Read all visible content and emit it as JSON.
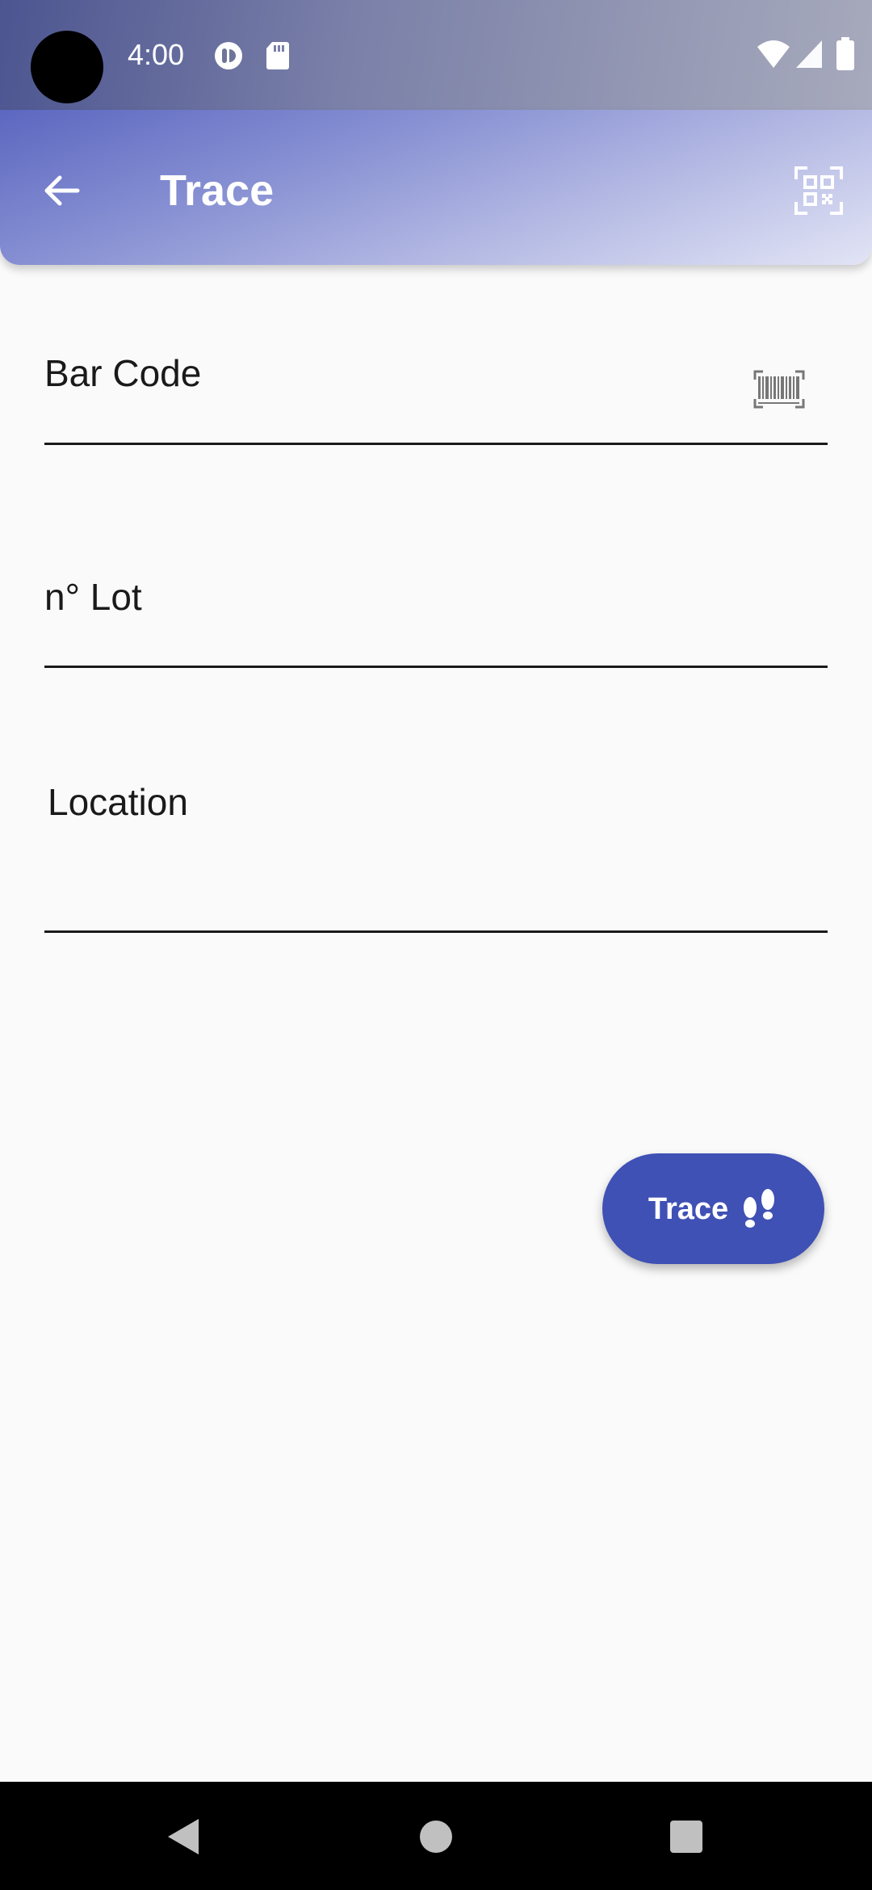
{
  "status_bar": {
    "time": "4:00",
    "icons": [
      "cast-icon",
      "sd-card-icon",
      "wifi-icon",
      "cellular-signal-icon",
      "battery-icon"
    ]
  },
  "app_bar": {
    "title": "Trace",
    "back_icon": "arrow-back-icon",
    "action_icon": "qr-code-scanner-icon"
  },
  "form": {
    "barcode": {
      "label": "Bar Code",
      "icon": "barcode-scanner-icon"
    },
    "lot": {
      "label": "n° Lot"
    },
    "location": {
      "label": "Location"
    }
  },
  "fab": {
    "label": "Trace",
    "icon": "footprints-icon",
    "color": "#3f51b5"
  },
  "nav_bar": {
    "icons": [
      "nav-back-icon",
      "nav-home-icon",
      "nav-recents-icon"
    ]
  },
  "colors": {
    "background": "#fafafa",
    "primary": "#3f51b5",
    "app_bar_start": "#5c67c0",
    "app_bar_end": "#e2e4f5"
  }
}
